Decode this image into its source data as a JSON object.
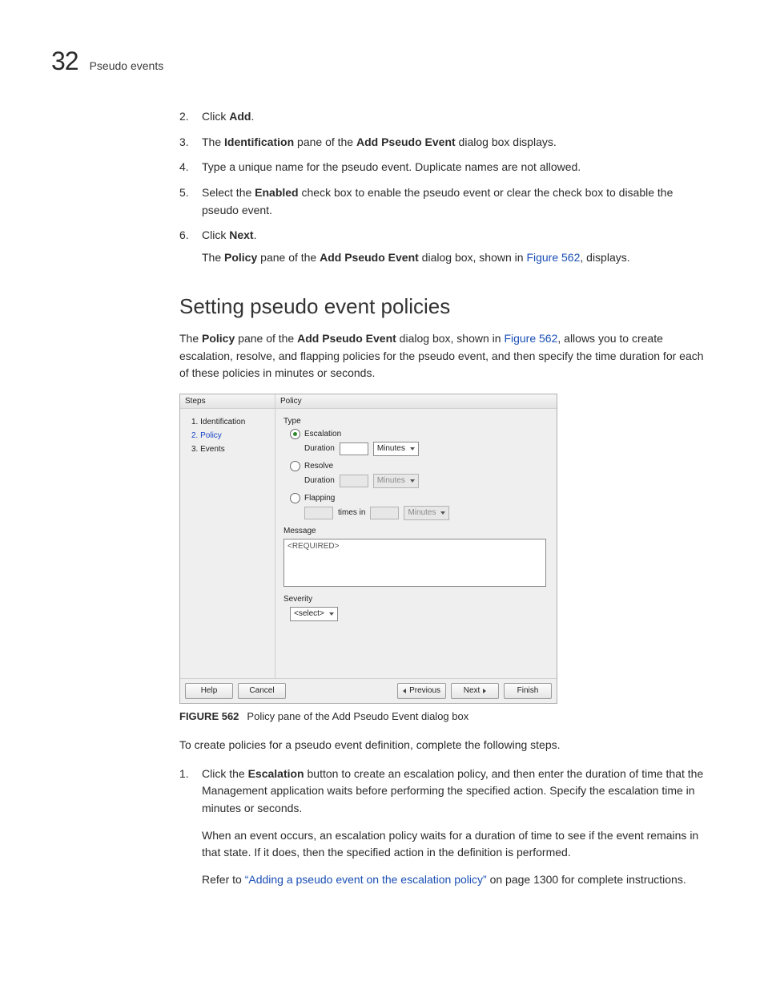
{
  "header": {
    "chapter_number": "32",
    "running_title": "Pseudo events"
  },
  "steps_top": [
    {
      "n": "2.",
      "pre": "Click ",
      "bold": "Add",
      "post": "."
    },
    {
      "n": "3.",
      "parts": [
        "The ",
        "Identification",
        " pane of the ",
        "Add Pseudo Event",
        " dialog box displays."
      ]
    },
    {
      "n": "4.",
      "plain": "Type a unique name for the pseudo event. Duplicate names are not allowed."
    },
    {
      "n": "5.",
      "parts": [
        "Select the ",
        "Enabled",
        " check box to enable the pseudo event or clear the check box to disable the pseudo event."
      ]
    },
    {
      "n": "6.",
      "pre": "Click ",
      "bold": "Next",
      "post": "."
    }
  ],
  "after_step6": {
    "t1": "The ",
    "b1": "Policy",
    "t2": " pane of the ",
    "b2": "Add Pseudo Event",
    "t3": " dialog box, shown in ",
    "link": "Figure 562",
    "t4": ", displays."
  },
  "section_title": "Setting pseudo event policies",
  "intro": {
    "t1": "The ",
    "b1": "Policy",
    "t2": " pane of the ",
    "b2": "Add Pseudo Event",
    "t3": " dialog box, shown in ",
    "link": "Figure 562",
    "t4": ", allows you to create escalation, resolve, and flapping policies for the pseudo event, and then specify the time duration for each of these policies in minutes or seconds."
  },
  "figure": {
    "caption_label": "FIGURE 562",
    "caption_text": "Policy pane of the Add Pseudo Event dialog box",
    "dialog": {
      "steps_header": "Steps",
      "policy_header": "Policy",
      "steps_items": [
        "1. Identification",
        "2. Policy",
        "3. Events"
      ],
      "type_label": "Type",
      "radios": {
        "escalation": "Escalation",
        "resolve": "Resolve",
        "flapping": "Flapping"
      },
      "duration_label": "Duration",
      "unit_minutes": "Minutes",
      "times_in": "times in",
      "message_label": "Message",
      "message_placeholder": "<REQUIRED>",
      "severity_label": "Severity",
      "severity_value": "<select>",
      "buttons": {
        "help": "Help",
        "cancel": "Cancel",
        "previous": "Previous",
        "next": "Next",
        "finish": "Finish"
      }
    }
  },
  "post_figure_para": "To create policies for a pseudo event definition, complete the following steps.",
  "step1": {
    "n": "1.",
    "t1": "Click the ",
    "b1": "Escalation",
    "t2": " button to create an escalation policy, and then enter the duration of time that the Management application waits before performing the specified action. Specify the escalation time in minutes or seconds."
  },
  "step1_p2": "When an event occurs, an escalation policy waits for a duration of time to see if the event remains in that state. If it does, then the specified action in the definition is performed.",
  "step1_p3": {
    "t1": "Refer to ",
    "link": "“Adding a pseudo event on the escalation policy”",
    "t2": " on page 1300 for complete instructions."
  }
}
